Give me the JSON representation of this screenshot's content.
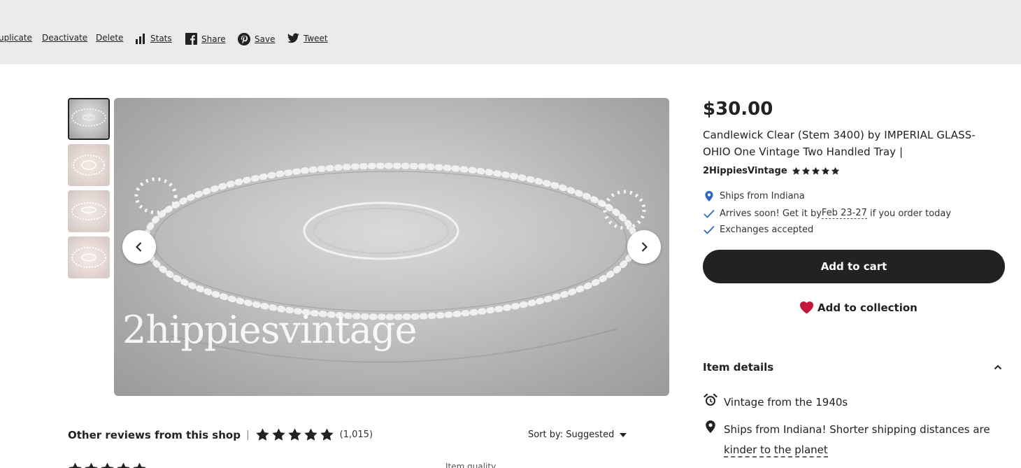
{
  "toolbar": {
    "links": [
      {
        "label": "uplicate"
      },
      {
        "label": "Deactivate"
      },
      {
        "label": "Delete"
      },
      {
        "label": "Stats",
        "icon": "bar-chart-icon"
      },
      {
        "label": "Share",
        "icon": "facebook-icon"
      },
      {
        "label": "Save",
        "icon": "pinterest-icon"
      },
      {
        "label": "Tweet",
        "icon": "twitter-icon"
      }
    ]
  },
  "gallery": {
    "watermark": "2hippiesvintage",
    "thumbnails": 4,
    "active_thumbnail": 1
  },
  "listing": {
    "price": "$30.00",
    "title": "Candlewick Clear (Stem 3400) by IMPERIAL GLASS-OHIO One Vintage Two Handled Tray |",
    "shop_name": "2HippiesVintage",
    "shop_rating": 5,
    "ships_from": "Ships from Indiana",
    "arrives_prefix": "Arrives soon! Get it by ",
    "arrives_date": "Feb 23-27",
    "arrives_suffix": " if you order today",
    "exchanges": "Exchanges accepted",
    "add_to_cart": "Add to cart",
    "add_to_collection": "Add to collection"
  },
  "item_details": {
    "heading": "Item details",
    "vintage": "Vintage from the 1940s",
    "shipping_note_prefix": "Ships from Indiana! Shorter shipping distances are ",
    "shipping_note_link": "kinder to the planet"
  },
  "reviews": {
    "title": "Other reviews from this shop",
    "separator": "|",
    "rating": 5,
    "count": "(1,015)",
    "sort_label": "Sort by: Suggested",
    "cut_text_1": "Item quality"
  },
  "colors": {
    "toolbar_bg": "#ebebeb",
    "button_dark": "#222222",
    "heart": "#c4163b",
    "check_blue": "#2f66c9",
    "pin_blue": "#2f66c9"
  }
}
